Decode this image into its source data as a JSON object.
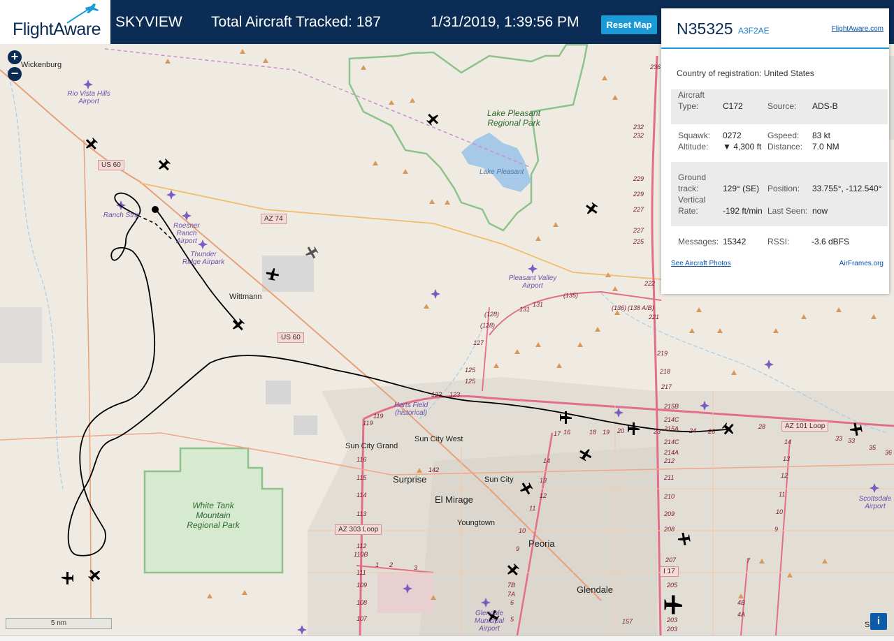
{
  "header": {
    "logo": "FlightAware",
    "app_name": "SKYVIEW",
    "total_tracked": "Total Aircraft Tracked: 187",
    "datetime": "1/31/2019, 1:39:56 PM",
    "reset_button": "Reset Map"
  },
  "controls": {
    "zoom_in": "+",
    "zoom_out": "−",
    "scale": "5 nm",
    "info": "i"
  },
  "panel": {
    "registration": "N35325",
    "hex": "A3F2AE",
    "flightaware_link": "FlightAware.com",
    "country_label": "Country of registration:",
    "country_value": "United States",
    "aircraft_type_label": "Aircraft Type:",
    "aircraft_type": "C172",
    "source_label": "Source:",
    "source": "ADS-B",
    "squawk_label": "Squawk:",
    "squawk": "0272",
    "gspeed_label": "Gspeed:",
    "gspeed": "83 kt",
    "altitude_label": "Altitude:",
    "altitude": "▼ 4,300 ft",
    "distance_label": "Distance:",
    "distance": "7.0 NM",
    "ground_track_label": "Ground track:",
    "ground_track": "129° (SE)",
    "position_label": "Position:",
    "position": "33.755°, -112.540°",
    "vertical_rate_label": "Vertical Rate:",
    "vertical_rate": "-192 ft/min",
    "last_seen_label": "Last Seen:",
    "last_seen": "now",
    "messages_label": "Messages:",
    "messages": "15342",
    "rssi_label": "RSSI:",
    "rssi": "-3.6 dBFS",
    "photos_link": "See Aircraft Photos",
    "airframes_link": "AirFrames.org"
  },
  "map": {
    "places": [
      "Wickenburg",
      "Wittmann",
      "Sun City Grand",
      "Sun City West",
      "Surprise",
      "El Mirage",
      "Sun City",
      "Youngtown",
      "Peoria",
      "Glendale",
      "Scotts"
    ],
    "parks": [
      "Lake Pleasant Regional Park",
      "White Tank Mountain Regional Park"
    ],
    "water": [
      "Lake Pleasant"
    ],
    "airports": [
      "Rio Vista Hills Airport",
      "Ranch Strip",
      "Roesner Ranch Airport",
      "Thunder Ridge Airpark",
      "Pleasant Valley Airport",
      "Harts Field (historical)",
      "Glendale Municipal Airport",
      "Scottsdale Airport"
    ],
    "road_shields": [
      "US 60",
      "AZ 74",
      "US 60",
      "AZ 101 Loop",
      "AZ 303 Loop",
      "I 17"
    ],
    "hw_markers": [
      "236",
      "232",
      "232",
      "229",
      "229",
      "227",
      "227",
      "225",
      "222",
      "221",
      "219",
      "218",
      "217",
      "215B",
      "214C",
      "215A",
      "214C",
      "214A",
      "212",
      "211",
      "210",
      "209",
      "208",
      "207",
      "205",
      "203",
      "203",
      "(135)",
      "(136)",
      "(138 A/B)",
      "131",
      "131",
      "(128)",
      "(128)",
      "127",
      "125",
      "125",
      "123",
      "123",
      "119",
      "119",
      "116",
      "115",
      "114",
      "113",
      "112",
      "110B",
      "111",
      "109",
      "108",
      "107",
      "1",
      "2",
      "3",
      "142",
      "17",
      "16",
      "18",
      "19",
      "20",
      "23",
      "24",
      "26",
      "28",
      "33",
      "33",
      "35",
      "36",
      "14",
      "13",
      "12",
      "11",
      "10",
      "9",
      "7B",
      "7A",
      "6",
      "5",
      "4B",
      "4A",
      "14",
      "13",
      "12",
      "11",
      "10",
      "9",
      "7",
      "157"
    ]
  }
}
